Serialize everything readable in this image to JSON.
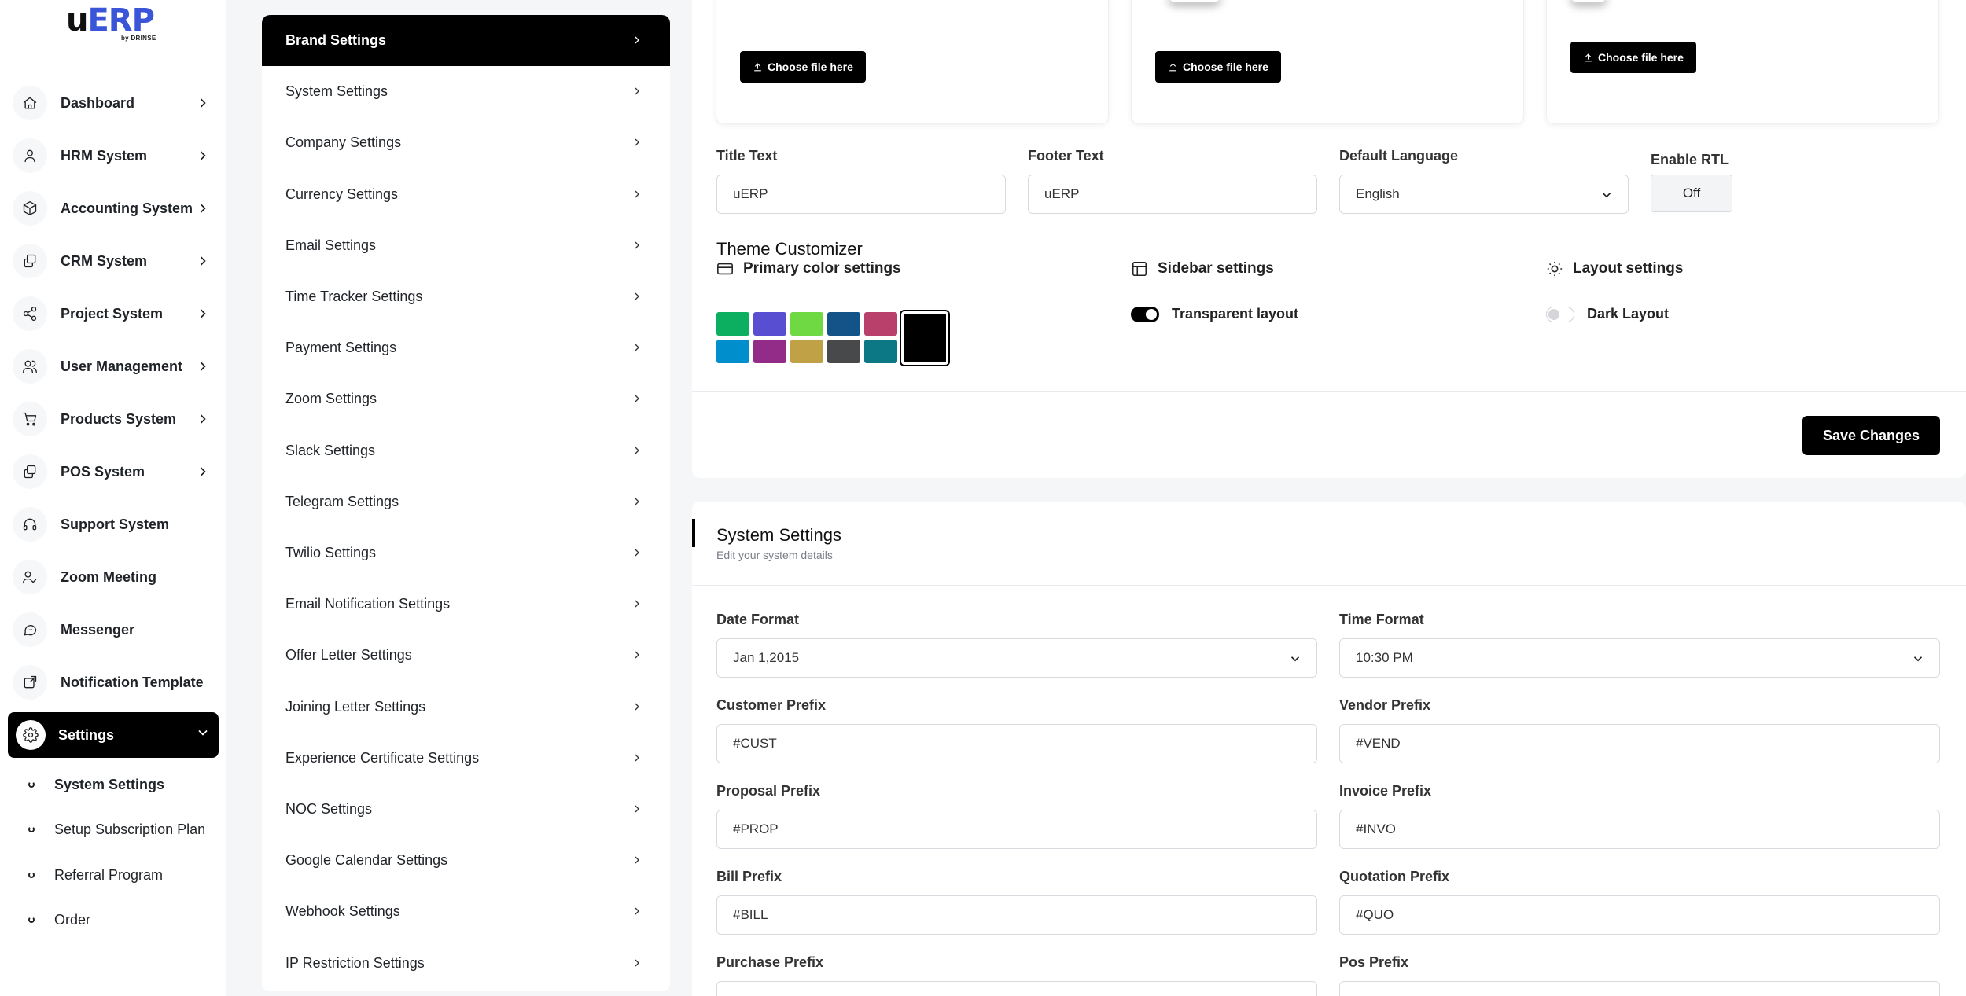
{
  "app": {
    "logo_main": "u",
    "logo_accent": "ERP",
    "logo_by": "by DRINSE"
  },
  "sidebar": {
    "items": [
      {
        "label": "Dashboard",
        "icon": "home-icon"
      },
      {
        "label": "HRM System",
        "icon": "user-icon"
      },
      {
        "label": "Accounting System",
        "icon": "box-icon"
      },
      {
        "label": "CRM System",
        "icon": "layers-icon"
      },
      {
        "label": "Project System",
        "icon": "share-icon"
      },
      {
        "label": "User Management",
        "icon": "users-icon"
      },
      {
        "label": "Products System",
        "icon": "cart-icon"
      },
      {
        "label": "POS System",
        "icon": "layers-icon"
      },
      {
        "label": "Support System",
        "icon": "headphones-icon"
      },
      {
        "label": "Zoom Meeting",
        "icon": "user-check-icon"
      },
      {
        "label": "Messenger",
        "icon": "message-icon"
      },
      {
        "label": "Notification Template",
        "icon": "external-icon"
      },
      {
        "label": "Settings",
        "icon": "gear-icon"
      }
    ],
    "subitems": [
      {
        "label": "System Settings"
      },
      {
        "label": "Setup Subscription Plan"
      },
      {
        "label": "Referral Program"
      },
      {
        "label": "Order"
      }
    ]
  },
  "settings_menu": {
    "items": [
      "Brand Settings",
      "System Settings",
      "Company Settings",
      "Currency Settings",
      "Email Settings",
      "Time Tracker Settings",
      "Payment Settings",
      "Zoom Settings",
      "Slack Settings",
      "Telegram Settings",
      "Twilio Settings",
      "Email Notification Settings",
      "Offer Letter Settings",
      "Joining Letter Settings",
      "Experience Certificate Settings",
      "NOC Settings",
      "Google Calendar Settings",
      "Webhook Settings",
      "IP Restriction Settings"
    ]
  },
  "brand": {
    "choose_file_label": "Choose file here",
    "title_text_label": "Title Text",
    "title_text_value": "uERP",
    "footer_text_label": "Footer Text",
    "footer_text_value": "uERP",
    "default_language_label": "Default Language",
    "default_language_value": "English",
    "enable_rtl_label": "Enable RTL",
    "enable_rtl_value": "Off",
    "theme_customizer": "Theme Customizer",
    "primary_color_settings": "Primary color settings",
    "sidebar_settings": "Sidebar settings",
    "layout_settings": "Layout settings",
    "transparent_layout": "Transparent layout",
    "transparent_layout_on": true,
    "dark_layout": "Dark Layout",
    "dark_layout_on": false,
    "colors": [
      "#0caf60",
      "#584ed2",
      "#6fd943",
      "#145388",
      "#b9406b",
      "#008ecc",
      "#922c88",
      "#c0a145",
      "#48494b",
      "#0c7785",
      "#000000"
    ],
    "selected_color": "#000000",
    "save_label": "Save Changes"
  },
  "system": {
    "title": "System Settings",
    "subtitle": "Edit your system details",
    "date_format_label": "Date Format",
    "date_format_value": "Jan 1,2015",
    "time_format_label": "Time Format",
    "time_format_value": "10:30 PM",
    "customer_prefix_label": "Customer Prefix",
    "customer_prefix_value": "#CUST",
    "vendor_prefix_label": "Vendor Prefix",
    "vendor_prefix_value": "#VEND",
    "proposal_prefix_label": "Proposal Prefix",
    "proposal_prefix_value": "#PROP",
    "invoice_prefix_label": "Invoice Prefix",
    "invoice_prefix_value": "#INVO",
    "bill_prefix_label": "Bill Prefix",
    "bill_prefix_value": "#BILL",
    "quotation_prefix_label": "Quotation Prefix",
    "quotation_prefix_value": "#QUO",
    "purchase_prefix_label": "Purchase Prefix",
    "pos_prefix_label": "Pos Prefix"
  }
}
